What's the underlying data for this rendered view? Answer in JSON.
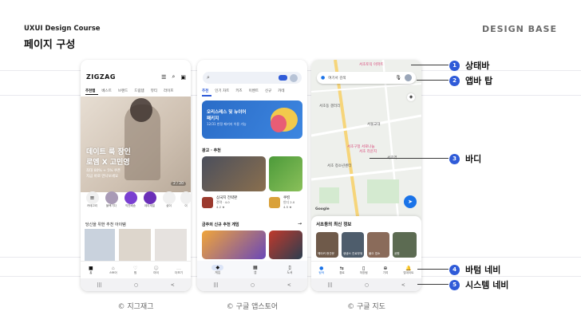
{
  "header": {
    "course": "UXUI Design Course",
    "title": "페이지 구성",
    "brand": "DESIGN BASE"
  },
  "zigzag": {
    "logo": "ZIGZAG",
    "tabs": [
      "추천탭",
      "베스트",
      "브랜드",
      "드림템",
      "뷰티",
      "라이프"
    ],
    "hero_title_1": "데이트 룩 장인",
    "hero_title_2": "로엠 X 고민영",
    "hero_sub_1": "최대 80% + 5% 쿠폰",
    "hero_sub_2": "지금 바로 만나보세요",
    "hero_counter": "2 / 20",
    "categories": [
      "카테고리",
      "블랙기다",
      "직진배송",
      "데이세일",
      "샵이",
      "이"
    ],
    "section": "당신을 위한 추천 아이템",
    "nav": [
      "홈",
      "스토어",
      "찜",
      "마이",
      "더보기"
    ]
  },
  "playstore": {
    "search_icon": "search-icon",
    "tabs": [
      "추천",
      "인기 차트",
      "키즈",
      "이벤트",
      "신규",
      "카테"
    ],
    "promo_1": "오리스레스 및 뉴이어",
    "promo_2": "패키지",
    "promo_3": "12/31 한정 패키지 이용 가능",
    "section1": "광고 · 추천",
    "game1_title": "삼국지 전략판",
    "game1_sub": "전략 · 4.0",
    "game1_rating": "4.2 ★",
    "game2_title": "쿠킹",
    "game2_sub": "인디 2.0",
    "game2_rating": "4.5 ★",
    "section2": "금주의 신규 추천 게임",
    "section2_arrow": "→",
    "nav": [
      "게임",
      "앱",
      "도서"
    ]
  },
  "maps": {
    "search_placeholder": "여기서 검색",
    "places": [
      "서초토익 아파트",
      "서초동 갤러리",
      "서울교대",
      "서초구청 서로나눔",
      "서초 라운지",
      "서초역",
      "서초 청소년센터"
    ],
    "google": "Google",
    "sheet_title": "서초동의 최신 정보",
    "cards": [
      "헤어커 현관문",
      "생생스 진료부위",
      "붙으 업소",
      "공원"
    ],
    "nav": [
      "탐색",
      "경로",
      "저장됨",
      "기여",
      "업데이트"
    ]
  },
  "callouts": [
    {
      "num": "1",
      "label": "상태바"
    },
    {
      "num": "2",
      "label": "앱바 탑"
    },
    {
      "num": "3",
      "label": "바디"
    },
    {
      "num": "4",
      "label": "바텀 네비"
    },
    {
      "num": "5",
      "label": "시스템 네비"
    }
  ],
  "system_nav": [
    "|||",
    "○",
    "<"
  ],
  "captions": [
    "© 지그재그",
    "© 구글 앱스토어",
    "© 구글 지도"
  ],
  "colors": {
    "accent": "#2f5bd8",
    "maps_blue": "#1a73e8",
    "zigzag_badge": "#7a3fd1"
  }
}
